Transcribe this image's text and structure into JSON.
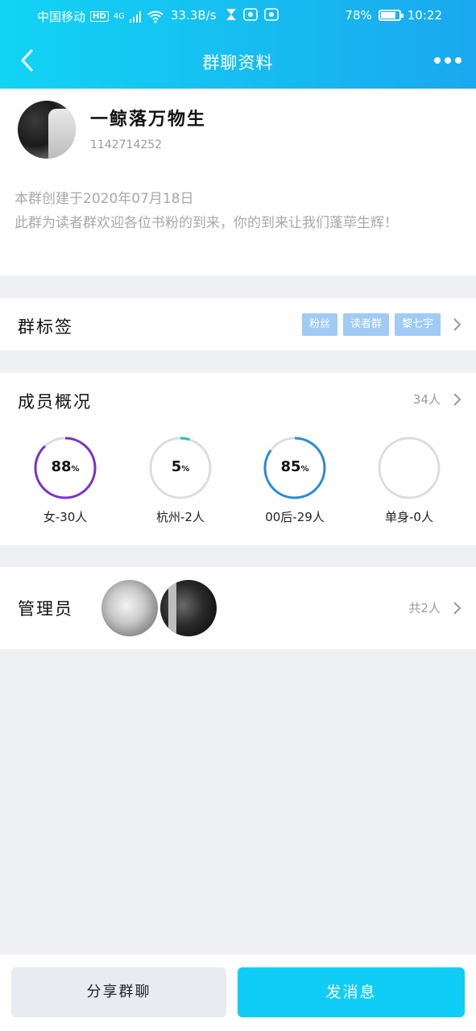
{
  "status_bar": {
    "carrier": "中国移动",
    "hd": "HD",
    "network": "4G",
    "speed": "33.3B/s",
    "battery": "78%",
    "time": "10:22"
  },
  "nav": {
    "title": "群聊资料"
  },
  "profile": {
    "group_name": "一鲸落万物生",
    "group_id": "1142714252",
    "description_line1": "本群创建于2020年07月18日",
    "description_line2": "此群为读者群欢迎各位书粉的到来，你的到来让我们蓬荜生辉！"
  },
  "tags_section": {
    "title": "群标签",
    "tags": [
      "粉丝",
      "读者群",
      "黎七宇"
    ]
  },
  "members_section": {
    "title": "成员概况",
    "count": "34人",
    "stats": [
      {
        "value": "88",
        "unit": "%",
        "label": "女-30人",
        "fraction": 0.88,
        "color": "#7b2fd0"
      },
      {
        "value": "5",
        "unit": "%",
        "label": "杭州-2人",
        "fraction": 0.05,
        "color": "#19c6c8"
      },
      {
        "value": "85",
        "unit": "%",
        "label": "00后-29人",
        "fraction": 0.85,
        "color": "#2a8ad8"
      },
      {
        "value": "",
        "unit": "",
        "label": "单身-0人",
        "fraction": 0,
        "color": "#dddddd"
      }
    ]
  },
  "admin_section": {
    "title": "管理员",
    "count": "共2人"
  },
  "bottom": {
    "share_label": "分享群聊",
    "send_label": "发消息"
  }
}
